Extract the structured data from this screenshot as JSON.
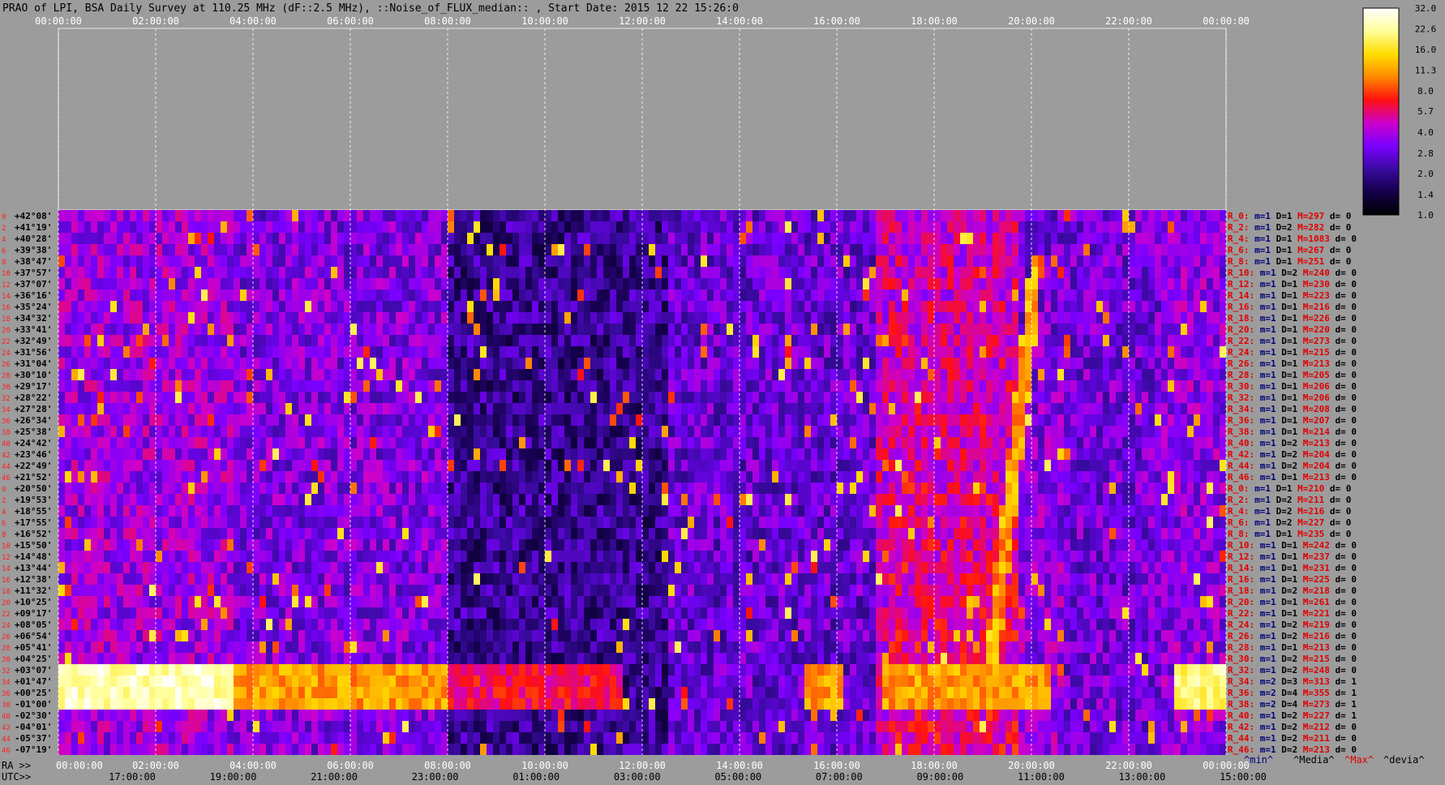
{
  "chart_data": {
    "type": "heatmap",
    "title": "PRAO of LPI, BSA Daily Survey at 110.25 MHz (dF::2.5 MHz), ::Noise_of_FLUX_median:: , Start Date: 2015 12 22 15:26:0",
    "top_time_ticks": [
      "00:00:00",
      "02:00:00",
      "04:00:00",
      "06:00:00",
      "08:00:00",
      "10:00:00",
      "12:00:00",
      "14:00:00",
      "16:00:00",
      "18:00:00",
      "20:00:00",
      "22:00:00",
      "00:00:00"
    ],
    "ra_axis_label": "RA >>",
    "ra_ticks": [
      "00:00:00",
      "02:00:00",
      "04:00:00",
      "06:00:00",
      "08:00:00",
      "10:00:00",
      "12:00:00",
      "14:00:00",
      "16:00:00",
      "18:00:00",
      "20:00:00",
      "22:00:00",
      "00:00:00"
    ],
    "utc_axis_label": "UTC>>",
    "utc_ticks": [
      "17:00:00",
      "19:00:00",
      "21:00:00",
      "23:00:00",
      "01:00:00",
      "03:00:00",
      "05:00:00",
      "07:00:00",
      "09:00:00",
      "11:00:00",
      "13:00:00",
      "15:00:00"
    ],
    "colorbar_ticks": [
      "32.0",
      "22.6",
      "16.0",
      "11.3",
      "8.0",
      "5.7",
      "4.0",
      "2.8",
      "2.0",
      "1.4",
      "1.0"
    ],
    "colorbar_range": [
      1.0,
      32.0
    ],
    "colorbar_scale": "log",
    "colorbar_colors": [
      "#ffffff",
      "#ffff9a",
      "#ffdd00",
      "#ff8800",
      "#ff1010",
      "#cc00cc",
      "#7a00ff",
      "#3a0aa0",
      "#14004a",
      "#000000"
    ],
    "declinations": [
      "+42°08'",
      "+41°19'",
      "+40°28'",
      "+39°38'",
      "+38°47'",
      "+37°57'",
      "+37°07'",
      "+36°16'",
      "+35°24'",
      "+34°32'",
      "+33°41'",
      "+32°49'",
      "+31°56'",
      "+31°04'",
      "+30°10'",
      "+29°17'",
      "+28°22'",
      "+27°28'",
      "+26°34'",
      "+25°38'",
      "+24°42'",
      "+23°46'",
      "+22°49'",
      "+21°52'",
      "+20°50'",
      "+19°53'",
      "+18°55'",
      "+17°55'",
      "+16°52'",
      "+15°50'",
      "+14°48'",
      "+13°44'",
      "+12°38'",
      "+11°32'",
      "+10°25'",
      "+09°17'",
      "+08°05'",
      "+06°54'",
      "+05°41'",
      "+04°25'",
      "+03°07'",
      "+01°47'",
      "+00°25'",
      "-01°00'",
      "-02°30'",
      "-04°01'",
      "-05°37'",
      "-07°19'"
    ],
    "beam_numbers": [
      "0",
      "2",
      "4",
      "6",
      "8",
      "10",
      "12",
      "14",
      "16",
      "18",
      "20",
      "22",
      "24",
      "26",
      "28",
      "30",
      "32",
      "34",
      "36",
      "38",
      "40",
      "42",
      "44",
      "46",
      "0",
      "2",
      "4",
      "6",
      "8",
      "10",
      "12",
      "14",
      "16",
      "18",
      "20",
      "22",
      "24",
      "26",
      "28",
      "30",
      "32",
      "34",
      "36",
      "38",
      "40",
      "42",
      "44",
      "46"
    ],
    "row_stats": [
      {
        "r": "R_0:",
        "m": "m=1",
        "d": "D=1",
        "M": "M=297",
        "dv": "d= 0"
      },
      {
        "r": "R_2:",
        "m": "m=1",
        "d": "D=2",
        "M": "M=282",
        "dv": "d= 0"
      },
      {
        "r": "R_4:",
        "m": "m=1",
        "d": "D=1",
        "M": "M=1083",
        "dv": "d= 0"
      },
      {
        "r": "R_6:",
        "m": "m=1",
        "d": "D=1",
        "M": "M=267",
        "dv": "d= 0"
      },
      {
        "r": "R_8:",
        "m": "m=1",
        "d": "D=1",
        "M": "M=251",
        "dv": "d= 0"
      },
      {
        "r": "R_10:",
        "m": "m=1",
        "d": "D=2",
        "M": "M=240",
        "dv": "d= 0"
      },
      {
        "r": "R_12:",
        "m": "m=1",
        "d": "D=1",
        "M": "M=230",
        "dv": "d= 0"
      },
      {
        "r": "R_14:",
        "m": "m=1",
        "d": "D=1",
        "M": "M=223",
        "dv": "d= 0"
      },
      {
        "r": "R_16:",
        "m": "m=1",
        "d": "D=1",
        "M": "M=216",
        "dv": "d= 0"
      },
      {
        "r": "R_18:",
        "m": "m=1",
        "d": "D=1",
        "M": "M=226",
        "dv": "d= 0"
      },
      {
        "r": "R_20:",
        "m": "m=1",
        "d": "D=1",
        "M": "M=220",
        "dv": "d= 0"
      },
      {
        "r": "R_22:",
        "m": "m=1",
        "d": "D=1",
        "M": "M=273",
        "dv": "d= 0"
      },
      {
        "r": "R_24:",
        "m": "m=1",
        "d": "D=1",
        "M": "M=215",
        "dv": "d= 0"
      },
      {
        "r": "R_26:",
        "m": "m=1",
        "d": "D=1",
        "M": "M=213",
        "dv": "d= 0"
      },
      {
        "r": "R_28:",
        "m": "m=1",
        "d": "D=1",
        "M": "M=205",
        "dv": "d= 0"
      },
      {
        "r": "R_30:",
        "m": "m=1",
        "d": "D=1",
        "M": "M=206",
        "dv": "d= 0"
      },
      {
        "r": "R_32:",
        "m": "m=1",
        "d": "D=1",
        "M": "M=206",
        "dv": "d= 0"
      },
      {
        "r": "R_34:",
        "m": "m=1",
        "d": "D=1",
        "M": "M=208",
        "dv": "d= 0"
      },
      {
        "r": "R_36:",
        "m": "m=1",
        "d": "D=1",
        "M": "M=207",
        "dv": "d= 0"
      },
      {
        "r": "R_38:",
        "m": "m=1",
        "d": "D=1",
        "M": "M=214",
        "dv": "d= 0"
      },
      {
        "r": "R_40:",
        "m": "m=1",
        "d": "D=2",
        "M": "M=213",
        "dv": "d= 0"
      },
      {
        "r": "R_42:",
        "m": "m=1",
        "d": "D=2",
        "M": "M=204",
        "dv": "d= 0"
      },
      {
        "r": "R_44:",
        "m": "m=1",
        "d": "D=2",
        "M": "M=204",
        "dv": "d= 0"
      },
      {
        "r": "R_46:",
        "m": "m=1",
        "d": "D=1",
        "M": "M=213",
        "dv": "d= 0"
      },
      {
        "r": "R_0:",
        "m": "m=1",
        "d": "D=1",
        "M": "M=210",
        "dv": "d= 0"
      },
      {
        "r": "R_2:",
        "m": "m=1",
        "d": "D=2",
        "M": "M=211",
        "dv": "d= 0"
      },
      {
        "r": "R_4:",
        "m": "m=1",
        "d": "D=2",
        "M": "M=216",
        "dv": "d= 0"
      },
      {
        "r": "R_6:",
        "m": "m=1",
        "d": "D=2",
        "M": "M=227",
        "dv": "d= 0"
      },
      {
        "r": "R_8:",
        "m": "m=1",
        "d": "D=1",
        "M": "M=235",
        "dv": "d= 0"
      },
      {
        "r": "R_10:",
        "m": "m=1",
        "d": "D=1",
        "M": "M=242",
        "dv": "d= 0"
      },
      {
        "r": "R_12:",
        "m": "m=1",
        "d": "D=1",
        "M": "M=237",
        "dv": "d= 0"
      },
      {
        "r": "R_14:",
        "m": "m=1",
        "d": "D=1",
        "M": "M=231",
        "dv": "d= 0"
      },
      {
        "r": "R_16:",
        "m": "m=1",
        "d": "D=1",
        "M": "M=225",
        "dv": "d= 0"
      },
      {
        "r": "R_18:",
        "m": "m=1",
        "d": "D=2",
        "M": "M=218",
        "dv": "d= 0"
      },
      {
        "r": "R_20:",
        "m": "m=1",
        "d": "D=1",
        "M": "M=261",
        "dv": "d= 0"
      },
      {
        "r": "R_22:",
        "m": "m=1",
        "d": "D=1",
        "M": "M=221",
        "dv": "d= 0"
      },
      {
        "r": "R_24:",
        "m": "m=1",
        "d": "D=2",
        "M": "M=219",
        "dv": "d= 0"
      },
      {
        "r": "R_26:",
        "m": "m=1",
        "d": "D=2",
        "M": "M=216",
        "dv": "d= 0"
      },
      {
        "r": "R_28:",
        "m": "m=1",
        "d": "D=1",
        "M": "M=213",
        "dv": "d= 0"
      },
      {
        "r": "R_30:",
        "m": "m=1",
        "d": "D=2",
        "M": "M=215",
        "dv": "d= 0"
      },
      {
        "r": "R_32:",
        "m": "m=1",
        "d": "D=2",
        "M": "M=248",
        "dv": "d= 0"
      },
      {
        "r": "R_34:",
        "m": "m=2",
        "d": "D=3",
        "M": "M=313",
        "dv": "d= 1"
      },
      {
        "r": "R_36:",
        "m": "m=2",
        "d": "D=4",
        "M": "M=355",
        "dv": "d= 1"
      },
      {
        "r": "R_38:",
        "m": "m=2",
        "d": "D=4",
        "M": "M=273",
        "dv": "d= 1"
      },
      {
        "r": "R_40:",
        "m": "m=1",
        "d": "D=2",
        "M": "M=227",
        "dv": "d= 1"
      },
      {
        "r": "R_42:",
        "m": "m=1",
        "d": "D=2",
        "M": "M=212",
        "dv": "d= 0"
      },
      {
        "r": "R_44:",
        "m": "m=1",
        "d": "D=2",
        "M": "M=211",
        "dv": "d= 0"
      },
      {
        "r": "R_46:",
        "m": "m=1",
        "d": "D=2",
        "M": "M=213",
        "dv": "d= 0"
      }
    ],
    "footer_labels": {
      "min": "^min^",
      "median": "^Media^",
      "max": "^Max^",
      "deviation": "^devia^"
    },
    "grid": true
  }
}
